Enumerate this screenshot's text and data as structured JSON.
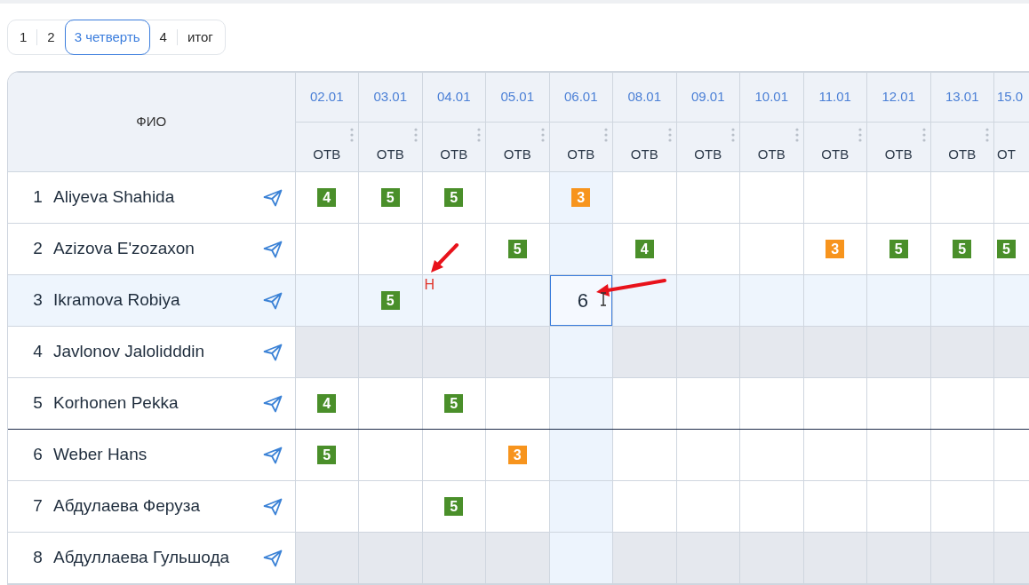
{
  "terms": [
    {
      "label": "1",
      "selected": false
    },
    {
      "label": "2",
      "selected": false
    },
    {
      "label": "3 четверть",
      "selected": true
    },
    {
      "label": "4",
      "selected": false
    },
    {
      "label": "итог",
      "selected": false
    }
  ],
  "table": {
    "name_header": "ФИО",
    "columns": [
      {
        "date": "02.01",
        "type": "ОТВ",
        "menu": true,
        "selected": false
      },
      {
        "date": "03.01",
        "type": "ОТВ",
        "menu": true,
        "selected": false
      },
      {
        "date": "04.01",
        "type": "ОТВ",
        "menu": true,
        "selected": false
      },
      {
        "date": "05.01",
        "type": "ОТВ",
        "menu": true,
        "selected": false
      },
      {
        "date": "06.01",
        "type": "ОТВ",
        "menu": true,
        "selected": true
      },
      {
        "date": "08.01",
        "type": "ОТВ",
        "menu": true,
        "selected": false
      },
      {
        "date": "09.01",
        "type": "ОТВ",
        "menu": true,
        "selected": false
      },
      {
        "date": "10.01",
        "type": "ОТВ",
        "menu": true,
        "selected": false
      },
      {
        "date": "11.01",
        "type": "ОТВ",
        "menu": true,
        "selected": false
      },
      {
        "date": "12.01",
        "type": "ОТВ",
        "menu": true,
        "selected": false
      },
      {
        "date": "13.01",
        "type": "ОТВ",
        "menu": true,
        "selected": false
      },
      {
        "date": "15.0",
        "type": "ОТ",
        "menu": false,
        "selected": false
      }
    ],
    "rows": [
      {
        "number": "1",
        "name": "Aliyeva Shahida",
        "selected": false,
        "inactive": false,
        "group_end": false,
        "cells": [
          {
            "kind": "grade",
            "value": "4",
            "color": "#4a8f2a"
          },
          {
            "kind": "grade",
            "value": "5",
            "color": "#4a8f2a"
          },
          {
            "kind": "grade",
            "value": "5",
            "color": "#4a8f2a"
          },
          {
            "kind": "empty"
          },
          {
            "kind": "grade",
            "value": "3",
            "color": "#f7941d"
          },
          {
            "kind": "empty"
          },
          {
            "kind": "empty"
          },
          {
            "kind": "empty"
          },
          {
            "kind": "empty"
          },
          {
            "kind": "empty"
          },
          {
            "kind": "empty"
          },
          {
            "kind": "empty"
          }
        ]
      },
      {
        "number": "2",
        "name": "Azizova E'zozaxon",
        "selected": false,
        "inactive": false,
        "group_end": false,
        "cells": [
          {
            "kind": "empty"
          },
          {
            "kind": "empty"
          },
          {
            "kind": "empty"
          },
          {
            "kind": "grade",
            "value": "5",
            "color": "#4a8f2a"
          },
          {
            "kind": "empty"
          },
          {
            "kind": "grade",
            "value": "4",
            "color": "#4a8f2a"
          },
          {
            "kind": "empty"
          },
          {
            "kind": "empty"
          },
          {
            "kind": "grade",
            "value": "3",
            "color": "#f7941d"
          },
          {
            "kind": "grade",
            "value": "5",
            "color": "#4a8f2a"
          },
          {
            "kind": "grade",
            "value": "5",
            "color": "#4a8f2a"
          },
          {
            "kind": "grade",
            "value": "5",
            "color": "#4a8f2a"
          }
        ]
      },
      {
        "number": "3",
        "name": "Ikramova Robiya",
        "selected": true,
        "inactive": false,
        "group_end": false,
        "cells": [
          {
            "kind": "empty"
          },
          {
            "kind": "grade",
            "value": "5",
            "color": "#4a8f2a"
          },
          {
            "kind": "absent",
            "value": "Н"
          },
          {
            "kind": "empty"
          },
          {
            "kind": "input",
            "value": "6"
          },
          {
            "kind": "empty"
          },
          {
            "kind": "empty"
          },
          {
            "kind": "empty"
          },
          {
            "kind": "empty"
          },
          {
            "kind": "empty"
          },
          {
            "kind": "empty"
          },
          {
            "kind": "empty"
          }
        ]
      },
      {
        "number": "4",
        "name": "Javlonov Jalolidddin",
        "selected": false,
        "inactive": true,
        "group_end": false,
        "cells": [
          {
            "kind": "empty"
          },
          {
            "kind": "empty"
          },
          {
            "kind": "empty"
          },
          {
            "kind": "empty"
          },
          {
            "kind": "empty"
          },
          {
            "kind": "empty"
          },
          {
            "kind": "empty"
          },
          {
            "kind": "empty"
          },
          {
            "kind": "empty"
          },
          {
            "kind": "empty"
          },
          {
            "kind": "empty"
          },
          {
            "kind": "empty"
          }
        ]
      },
      {
        "number": "5",
        "name": "Korhonen Pekka",
        "selected": false,
        "inactive": false,
        "group_end": true,
        "cells": [
          {
            "kind": "grade",
            "value": "4",
            "color": "#4a8f2a"
          },
          {
            "kind": "empty"
          },
          {
            "kind": "grade",
            "value": "5",
            "color": "#4a8f2a"
          },
          {
            "kind": "empty"
          },
          {
            "kind": "empty"
          },
          {
            "kind": "empty"
          },
          {
            "kind": "empty"
          },
          {
            "kind": "empty"
          },
          {
            "kind": "empty"
          },
          {
            "kind": "empty"
          },
          {
            "kind": "empty"
          },
          {
            "kind": "empty"
          }
        ]
      },
      {
        "number": "6",
        "name": "Weber Hans",
        "selected": false,
        "inactive": false,
        "group_end": false,
        "cells": [
          {
            "kind": "grade",
            "value": "5",
            "color": "#4a8f2a"
          },
          {
            "kind": "empty"
          },
          {
            "kind": "empty"
          },
          {
            "kind": "grade",
            "value": "3",
            "color": "#f7941d"
          },
          {
            "kind": "empty"
          },
          {
            "kind": "empty"
          },
          {
            "kind": "empty"
          },
          {
            "kind": "empty"
          },
          {
            "kind": "empty"
          },
          {
            "kind": "empty"
          },
          {
            "kind": "empty"
          },
          {
            "kind": "empty"
          }
        ]
      },
      {
        "number": "7",
        "name": "Абдулаева Феруза",
        "selected": false,
        "inactive": false,
        "group_end": false,
        "cells": [
          {
            "kind": "empty"
          },
          {
            "kind": "empty"
          },
          {
            "kind": "grade",
            "value": "5",
            "color": "#4a8f2a"
          },
          {
            "kind": "empty"
          },
          {
            "kind": "empty"
          },
          {
            "kind": "empty"
          },
          {
            "kind": "empty"
          },
          {
            "kind": "empty"
          },
          {
            "kind": "empty"
          },
          {
            "kind": "empty"
          },
          {
            "kind": "empty"
          },
          {
            "kind": "empty"
          }
        ]
      },
      {
        "number": "8",
        "name": "Абдуллаева Гульшода",
        "selected": false,
        "inactive": true,
        "group_end": false,
        "cells": [
          {
            "kind": "empty"
          },
          {
            "kind": "empty"
          },
          {
            "kind": "empty"
          },
          {
            "kind": "empty"
          },
          {
            "kind": "empty"
          },
          {
            "kind": "empty"
          },
          {
            "kind": "empty"
          },
          {
            "kind": "empty"
          },
          {
            "kind": "empty"
          },
          {
            "kind": "empty"
          },
          {
            "kind": "empty"
          },
          {
            "kind": "empty"
          }
        ]
      }
    ]
  }
}
